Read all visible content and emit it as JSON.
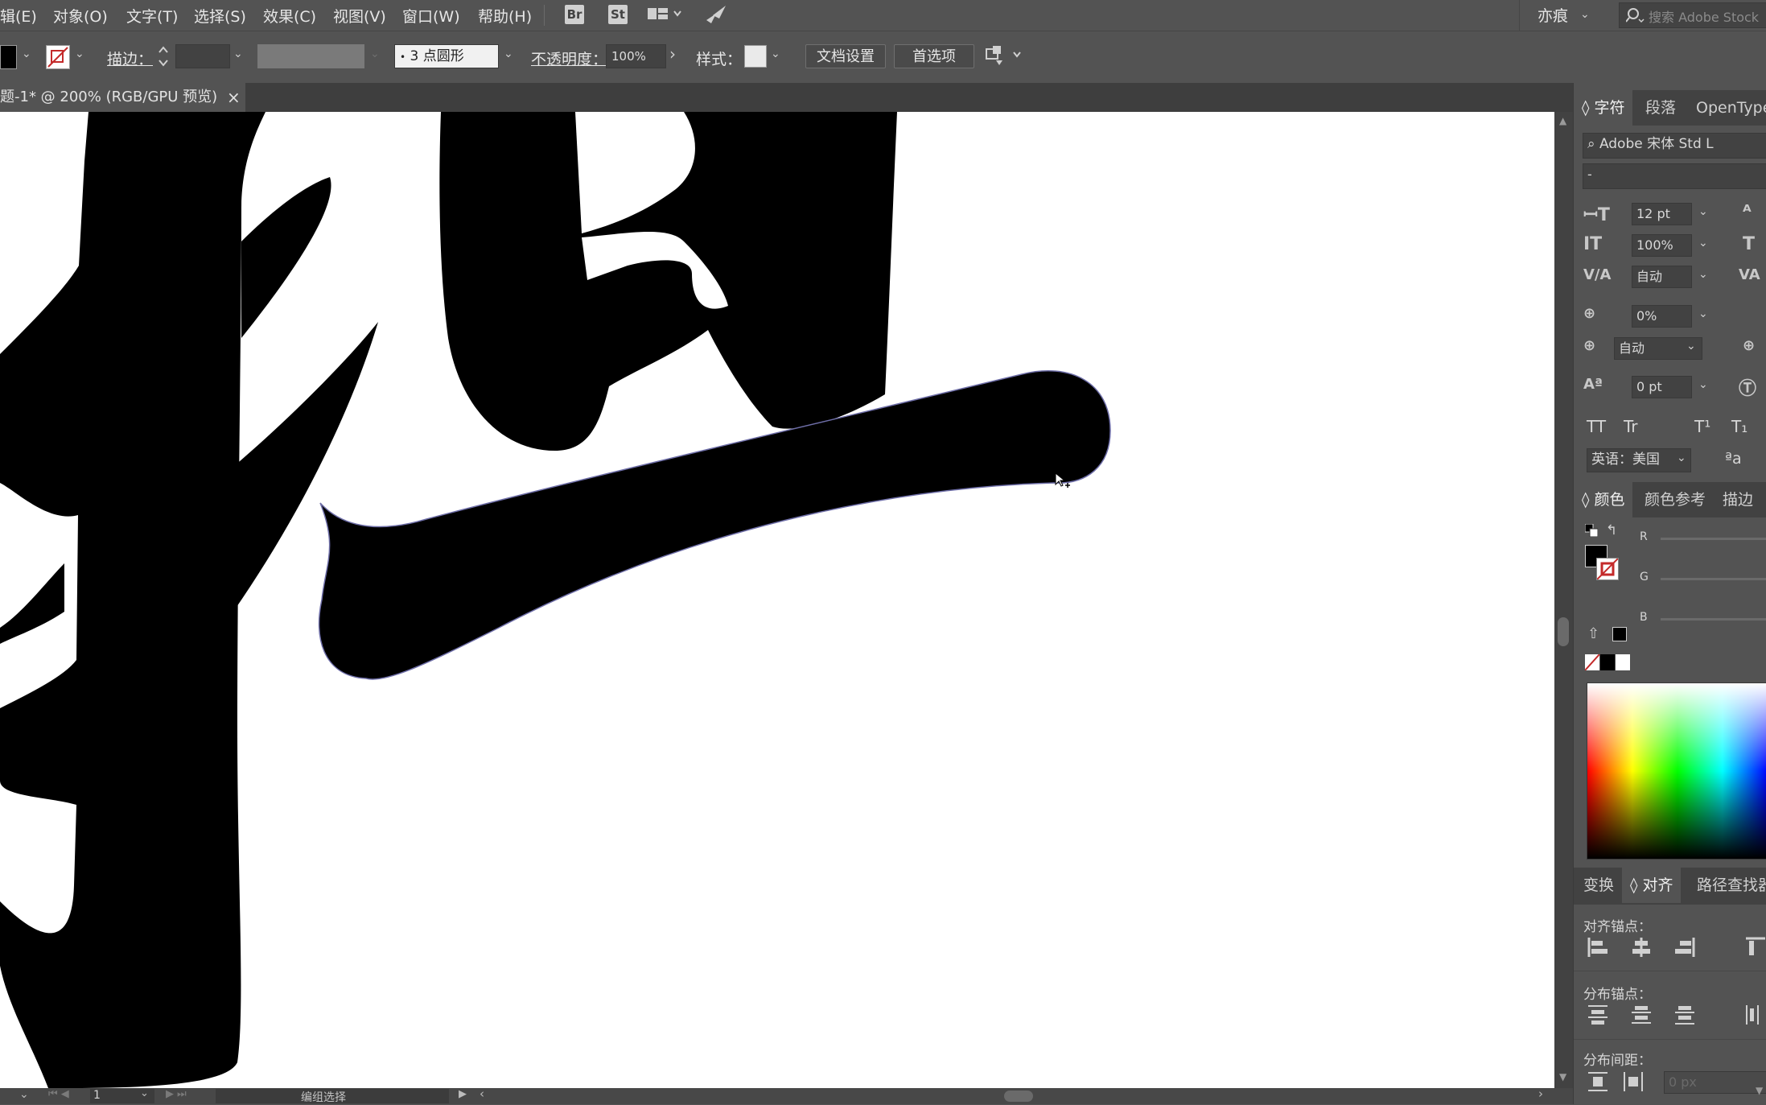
{
  "menubar": {
    "items": [
      "辑(E)",
      "对象(O)",
      "文字(T)",
      "选择(S)",
      "效果(C)",
      "视图(V)",
      "窗口(W)",
      "帮助(H)"
    ],
    "bridge_icon": "Br",
    "stock_icon": "St",
    "workspace": "亦痕",
    "search_placeholder": "搜索 Adobe Stock"
  },
  "controlbar": {
    "stroke_label": "描边：",
    "brush_value": "3 点圆形",
    "opacity_label": "不透明度：",
    "opacity_value": "100%",
    "style_label": "样式：",
    "doc_setup_button": "文档设置",
    "preferences_button": "首选项"
  },
  "document": {
    "tab_title": "题-1* @ 200% (RGB/GPU 预览)",
    "close_glyph": "×"
  },
  "statusbar": {
    "artboard_number": "1",
    "tool_status": "编组选择"
  },
  "panels": {
    "character": {
      "tabs": [
        "字符",
        "段落",
        "OpenType"
      ],
      "font_family": "Adobe 宋体 Std L",
      "font_style": "-",
      "font_size": "12 pt",
      "vertical_scale": "100%",
      "kerning": "自动",
      "tracking": "0%",
      "leading_auto": "自动",
      "baseline_shift": "0 pt",
      "language": "英语：美国",
      "type_buttons": [
        "TT",
        "Tr",
        "T¹",
        "T₁"
      ],
      "aa_label": "ªa"
    },
    "color": {
      "tabs": [
        "颜色",
        "颜色参考",
        "描边"
      ],
      "channels": [
        "R",
        "G",
        "B"
      ],
      "fill_color": "#000000"
    },
    "align": {
      "tabs": [
        "变换",
        "对齐",
        "路径查找器"
      ],
      "align_anchor_label": "对齐锚点：",
      "distribute_anchor_label": "分布锚点：",
      "distribute_spacing_label": "分布间距：",
      "spacing_value": "0 px"
    }
  }
}
